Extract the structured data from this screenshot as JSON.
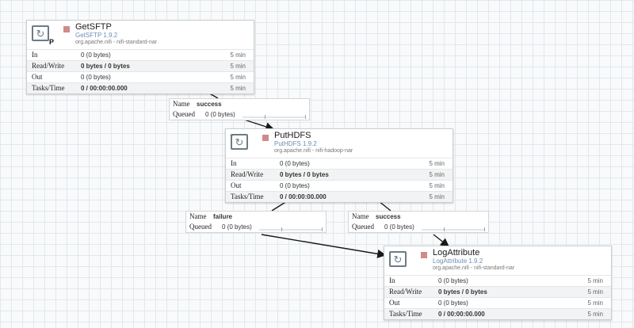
{
  "processors": [
    {
      "name": "GetSFTP",
      "type": "GetSFTP 1.9.2",
      "bundle": "org.apache.nifi - nifi-standard-nar",
      "badge": "P",
      "icon": "refresh-processor-icon",
      "status_color": "#d18a8a",
      "stats": {
        "in_label": "In",
        "in_value": "0 (0 bytes)",
        "in_window": "5 min",
        "rw_label": "Read/Write",
        "rw_value": "0 bytes / 0 bytes",
        "rw_window": "5 min",
        "out_label": "Out",
        "out_value": "0 (0 bytes)",
        "out_window": "5 min",
        "tasks_label": "Tasks/Time",
        "tasks_value": "0 / 00:00:00.000",
        "tasks_window": "5 min"
      }
    },
    {
      "name": "PutHDFS",
      "type": "PutHDFS 1.9.2",
      "bundle": "org.apache.nifi - nifi-hadoop-nar",
      "badge": "",
      "icon": "refresh-processor-icon",
      "status_color": "#d18a8a",
      "stats": {
        "in_label": "In",
        "in_value": "0 (0 bytes)",
        "in_window": "5 min",
        "rw_label": "Read/Write",
        "rw_value": "0 bytes / 0 bytes",
        "rw_window": "5 min",
        "out_label": "Out",
        "out_value": "0 (0 bytes)",
        "out_window": "5 min",
        "tasks_label": "Tasks/Time",
        "tasks_value": "0 / 00:00:00.000",
        "tasks_window": "5 min"
      }
    },
    {
      "name": "LogAttribute",
      "type": "LogAttribute 1.9.2",
      "bundle": "org.apache.nifi - nifi-standard-nar",
      "badge": "",
      "icon": "refresh-processor-icon",
      "status_color": "#d18a8a",
      "stats": {
        "in_label": "In",
        "in_value": "0 (0 bytes)",
        "in_window": "5 min",
        "rw_label": "Read/Write",
        "rw_value": "0 bytes / 0 bytes",
        "rw_window": "5 min",
        "out_label": "Out",
        "out_value": "0 (0 bytes)",
        "out_window": "5 min",
        "tasks_label": "Tasks/Time",
        "tasks_value": "0 / 00:00:00.000",
        "tasks_window": "5 min"
      }
    }
  ],
  "connections": [
    {
      "name_label": "Name",
      "name": "success",
      "queued_label": "Queued",
      "queued": "0 (0 bytes)"
    },
    {
      "name_label": "Name",
      "name": "failure",
      "queued_label": "Queued",
      "queued": "0 (0 bytes)"
    },
    {
      "name_label": "Name",
      "name": "success",
      "queued_label": "Queued",
      "queued": "0 (0 bytes)"
    }
  ],
  "colors": {
    "canvas_bg": "#f9fafb",
    "grid_line": "#e3e8eb",
    "processor_border": "#c9cfd2",
    "type_text": "#6d8fb0",
    "connector_line": "#1a1a1a"
  }
}
